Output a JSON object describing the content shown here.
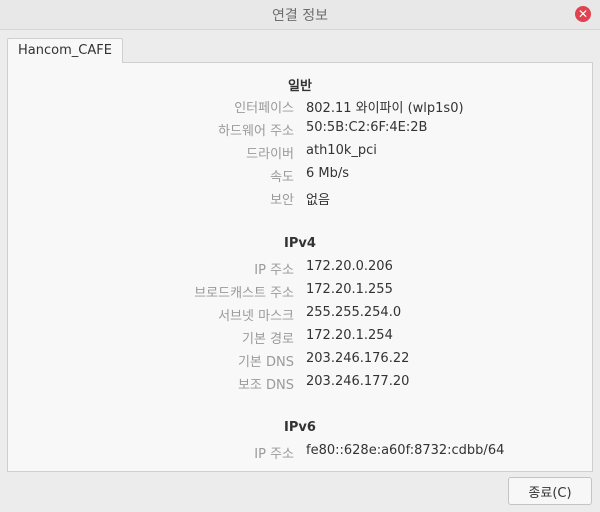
{
  "window": {
    "title": "연결 정보",
    "close_glyph": "✕"
  },
  "tab": {
    "label": "Hancom_CAFE"
  },
  "general": {
    "title": "일반",
    "rows": [
      {
        "label": "인터페이스",
        "value": "802.11 와이파이 (wlp1s0)"
      },
      {
        "label": "하드웨어 주소",
        "value": "50:5B:C2:6F:4E:2B"
      },
      {
        "label": "드라이버",
        "value": "ath10k_pci"
      },
      {
        "label": "속도",
        "value": "6 Mb/s"
      },
      {
        "label": "보안",
        "value": "없음"
      }
    ]
  },
  "ipv4": {
    "title": "IPv4",
    "rows": [
      {
        "label": "IP 주소",
        "value": "172.20.0.206"
      },
      {
        "label": "브로드캐스트 주소",
        "value": "172.20.1.255"
      },
      {
        "label": "서브넷 마스크",
        "value": "255.255.254.0"
      },
      {
        "label": "기본 경로",
        "value": "172.20.1.254"
      },
      {
        "label": "기본 DNS",
        "value": "203.246.176.22"
      },
      {
        "label": "보조 DNS",
        "value": "203.246.177.20"
      }
    ]
  },
  "ipv6": {
    "title": "IPv6",
    "rows": [
      {
        "label": "IP 주소",
        "value": "fe80::628e:a60f:8732:cdbb/64"
      }
    ]
  },
  "footer": {
    "close_label": "종료(C)"
  },
  "colors": {
    "close_accent": "#e0424f",
    "label_text": "#9a9a9a",
    "value_text": "#333333"
  }
}
